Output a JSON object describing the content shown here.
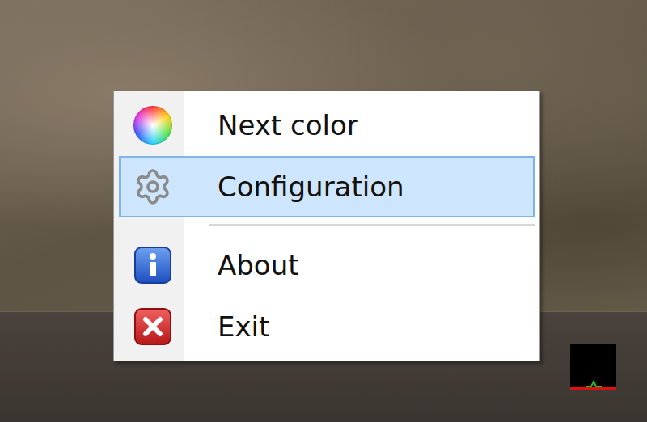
{
  "menu": {
    "groups": [
      {
        "items": [
          {
            "label": "Next color",
            "selected": false
          },
          {
            "label": "Configuration",
            "selected": true
          }
        ]
      },
      {
        "items": [
          {
            "label": "About",
            "selected": false
          },
          {
            "label": "Exit",
            "selected": false
          }
        ]
      }
    ]
  }
}
